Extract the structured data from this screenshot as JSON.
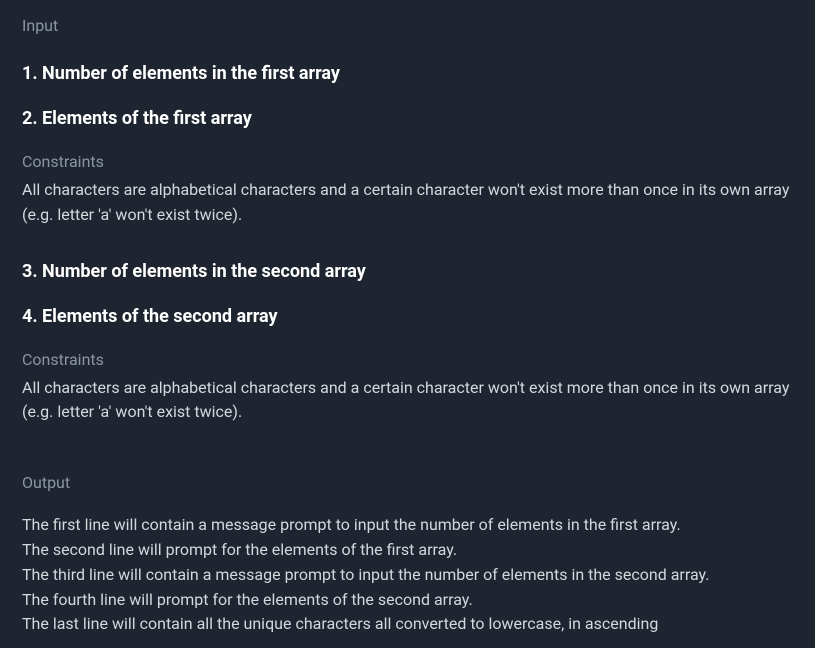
{
  "input": {
    "label": "Input",
    "items": [
      {
        "number": "1.",
        "text": "Number of elements in the first array"
      },
      {
        "number": "2.",
        "text": "Elements of the first array"
      }
    ],
    "constraints1": {
      "label": "Constraints",
      "text": "All characters are alphabetical characters and a certain character won't exist more than once in its own array (e.g. letter 'a' won't exist twice)."
    },
    "items2": [
      {
        "number": "3.",
        "text": "Number of elements in the second array"
      },
      {
        "number": "4.",
        "text": "Elements of the second array"
      }
    ],
    "constraints2": {
      "label": "Constraints",
      "text": "All characters are alphabetical characters and a certain character won't exist more than once in its own array (e.g. letter 'a' won't exist twice)."
    }
  },
  "output": {
    "label": "Output",
    "lines": [
      "The first line will contain a message prompt to input the number of elements in the first array.",
      "The second line will prompt for the elements of the first array.",
      "The third line will contain a message prompt to input the number of elements in the second array.",
      "The fourth line will prompt for the elements of the second array.",
      "The last line will contain all the unique characters all converted to lowercase, in ascending"
    ]
  }
}
